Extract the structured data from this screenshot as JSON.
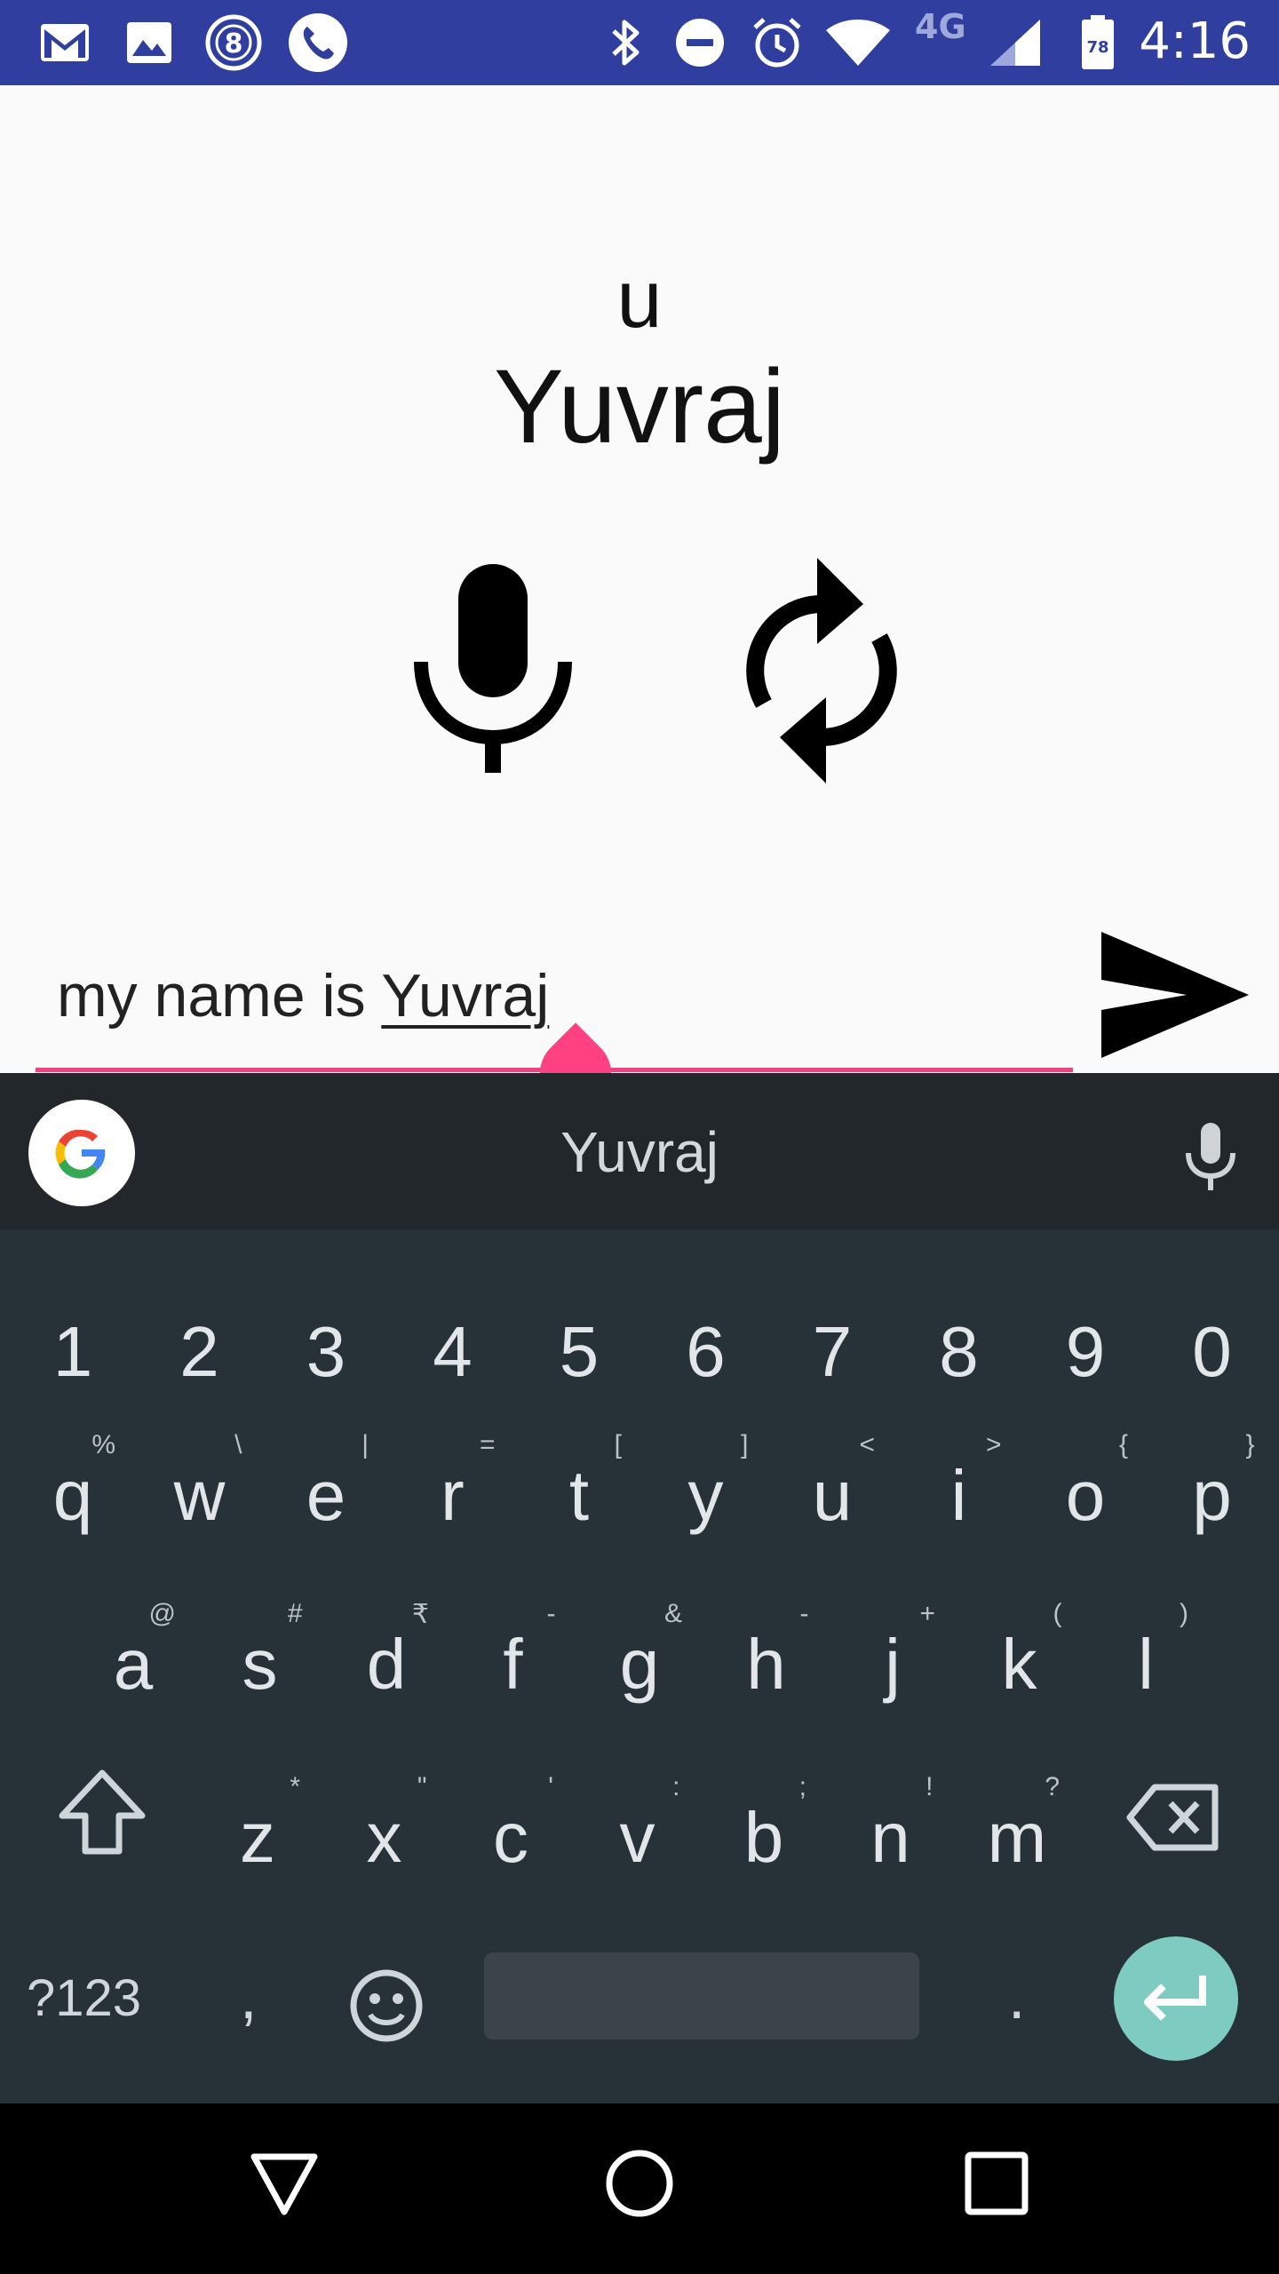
{
  "status_bar": {
    "time": "4:16",
    "network": "4G",
    "battery_level": "78",
    "icons": [
      "gmail-icon",
      "gallery-icon",
      "app-8-icon",
      "phone-icon",
      "bluetooth-icon",
      "do-not-disturb-icon",
      "alarm-icon",
      "wifi-icon",
      "signal-icon",
      "battery-icon"
    ]
  },
  "main": {
    "small_label": "u",
    "big_label": "Yuvraj",
    "mic_icon": "mic-icon",
    "refresh_icon": "refresh-icon"
  },
  "input": {
    "prefix": "my name is ",
    "composing": "Yuvraj",
    "accent_color": "#e8467c",
    "send_icon": "send-icon"
  },
  "keyboard": {
    "suggestion": "Yuvraj",
    "number_row": [
      "1",
      "2",
      "3",
      "4",
      "5",
      "6",
      "7",
      "8",
      "9",
      "0"
    ],
    "row1": [
      {
        "key": "q",
        "hint": "%"
      },
      {
        "key": "w",
        "hint": "\\"
      },
      {
        "key": "e",
        "hint": "|"
      },
      {
        "key": "r",
        "hint": "="
      },
      {
        "key": "t",
        "hint": "["
      },
      {
        "key": "y",
        "hint": "]"
      },
      {
        "key": "u",
        "hint": "<"
      },
      {
        "key": "i",
        "hint": ">"
      },
      {
        "key": "o",
        "hint": "{"
      },
      {
        "key": "p",
        "hint": "}"
      }
    ],
    "row2": [
      {
        "key": "a",
        "hint": "@"
      },
      {
        "key": "s",
        "hint": "#"
      },
      {
        "key": "d",
        "hint": "₹"
      },
      {
        "key": "f",
        "hint": "-"
      },
      {
        "key": "g",
        "hint": "&"
      },
      {
        "key": "h",
        "hint": "-"
      },
      {
        "key": "j",
        "hint": "+"
      },
      {
        "key": "k",
        "hint": "("
      },
      {
        "key": "l",
        "hint": ")"
      }
    ],
    "row3": [
      {
        "key": "z",
        "hint": "*"
      },
      {
        "key": "x",
        "hint": "\""
      },
      {
        "key": "c",
        "hint": "'"
      },
      {
        "key": "v",
        "hint": ":"
      },
      {
        "key": "b",
        "hint": ";"
      },
      {
        "key": "n",
        "hint": "!"
      },
      {
        "key": "m",
        "hint": "?"
      }
    ],
    "symbols_label": "?123",
    "comma": ",",
    "period": ".",
    "enter_color": "#7ecbc2"
  },
  "nav": {
    "back_icon": "back-icon",
    "home_icon": "home-icon",
    "recents_icon": "recents-icon"
  }
}
